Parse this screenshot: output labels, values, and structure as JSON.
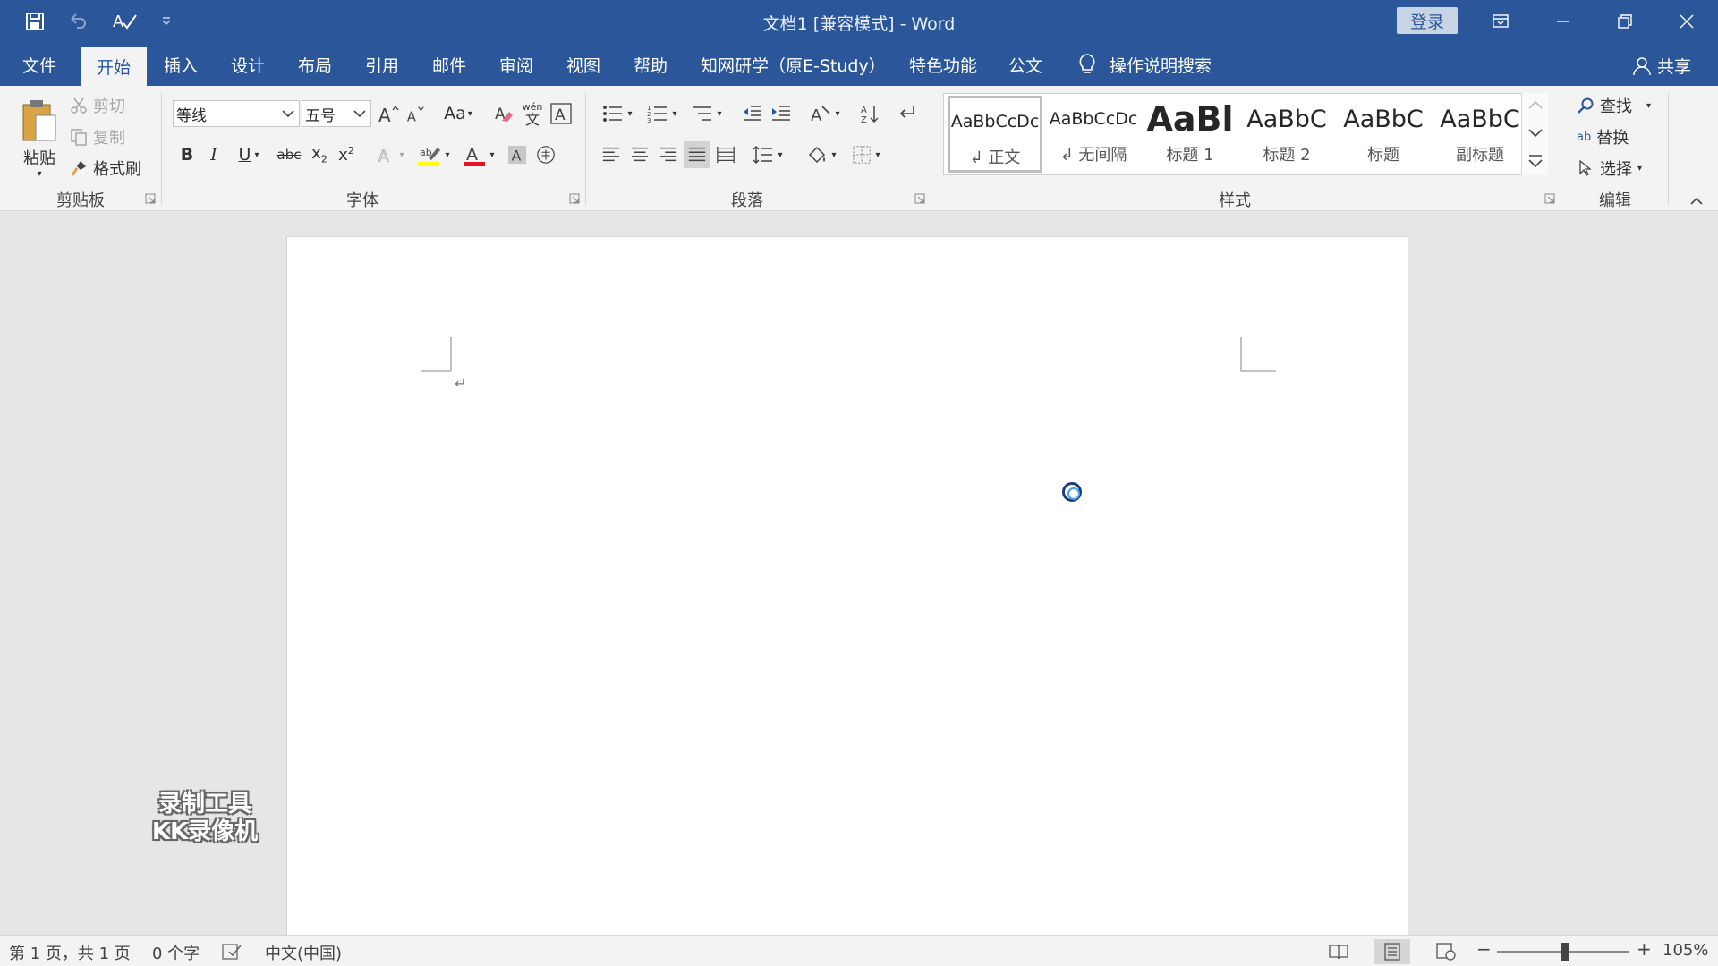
{
  "titlebar": {
    "title": "文档1 [兼容模式]  -  Word",
    "login_label": "登录",
    "icons": [
      "save-icon",
      "undo-icon",
      "spelling-icon",
      "customize-qat-icon",
      "ribbon-display-icon",
      "minimize-icon",
      "restore-icon",
      "close-icon"
    ]
  },
  "tabs": {
    "items": [
      {
        "label": "文件"
      },
      {
        "label": "开始"
      },
      {
        "label": "插入"
      },
      {
        "label": "设计"
      },
      {
        "label": "布局"
      },
      {
        "label": "引用"
      },
      {
        "label": "邮件"
      },
      {
        "label": "审阅"
      },
      {
        "label": "视图"
      },
      {
        "label": "帮助"
      },
      {
        "label": "知网研学（原E-Study）"
      },
      {
        "label": "特色功能"
      },
      {
        "label": "公文"
      }
    ],
    "active": "开始",
    "tell_me": "操作说明搜索",
    "share": "共享"
  },
  "clipboard": {
    "paste": "粘贴",
    "cut": "剪切",
    "copy": "复制",
    "format_painter": "格式刷",
    "group_label": "剪贴板"
  },
  "font": {
    "font_name": "等线",
    "font_size": "五号",
    "change_case": "Aa",
    "phonetic_top": "wén",
    "phonetic_bottom": "文",
    "group_label": "字体",
    "accent_highlight": "#ffff00",
    "accent_font_color": "#e81123"
  },
  "paragraph": {
    "group_label": "段落"
  },
  "styles": {
    "items": [
      {
        "sample": "AaBbCcDc",
        "name": "↲ 正文"
      },
      {
        "sample": "AaBbCcDc",
        "name": "↲ 无间隔"
      },
      {
        "sample": "AaBl",
        "name": "标题 1"
      },
      {
        "sample": "AaBbC",
        "name": "标题 2"
      },
      {
        "sample": "AaBbC",
        "name": "标题"
      },
      {
        "sample": "AaBbC",
        "name": "副标题"
      }
    ],
    "group_label": "样式"
  },
  "editing": {
    "find": "查找",
    "replace": "替换",
    "select": "选择",
    "replace_icon_text": "ab",
    "group_label": "编辑"
  },
  "document": {
    "paragraph_mark": "↵",
    "watermark_line1": "录制工具",
    "watermark_line2": "KK录像机"
  },
  "statusbar": {
    "page": "第 1 页，共 1 页",
    "words": "0 个字",
    "language": "中文(中国)",
    "zoom": "105%",
    "zoom_minus": "−",
    "zoom_plus": "+"
  },
  "colors": {
    "brand": "#2b579a",
    "ribbon": "#f3f3f3",
    "canvas": "#e6e6e6"
  }
}
